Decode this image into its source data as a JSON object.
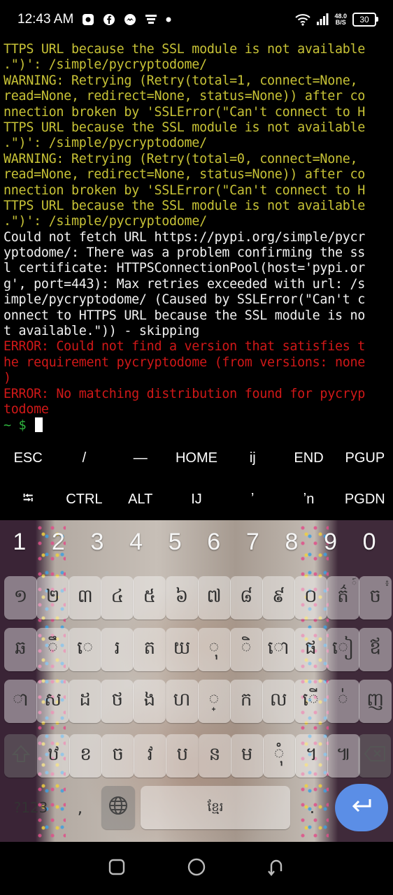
{
  "status_bar": {
    "time": "12:43 AM",
    "icons": [
      "messenger-icon",
      "facebook-icon",
      "messenger-circle-icon",
      "notification-icon",
      "dot-icon"
    ],
    "net_speed_value": "48.0",
    "net_speed_unit": "B/S",
    "battery": "30"
  },
  "terminal": {
    "lines": [
      {
        "text": "TTPS URL because the SSL module is not available",
        "style": "warn"
      },
      {
        "text": ".\")': /simple/pycryptodome/",
        "style": "warn"
      },
      {
        "text": "WARNING: Retrying (Retry(total=1, connect=None,",
        "style": "warn"
      },
      {
        "text": "read=None, redirect=None, status=None)) after co",
        "style": "warn"
      },
      {
        "text": "nnection broken by 'SSLError(\"Can't connect to H",
        "style": "warn"
      },
      {
        "text": "TTPS URL because the SSL module is not available",
        "style": "warn"
      },
      {
        "text": ".\")': /simple/pycryptodome/",
        "style": "warn"
      },
      {
        "text": "WARNING: Retrying (Retry(total=0, connect=None,",
        "style": "warn"
      },
      {
        "text": "read=None, redirect=None, status=None)) after co",
        "style": "warn"
      },
      {
        "text": "nnection broken by 'SSLError(\"Can't connect to H",
        "style": "warn"
      },
      {
        "text": "TTPS URL because the SSL module is not available",
        "style": "warn"
      },
      {
        "text": ".\")': /simple/pycryptodome/",
        "style": "warn"
      },
      {
        "text": "Could not fetch URL https://pypi.org/simple/pycr",
        "style": "norm"
      },
      {
        "text": "yptodome/: There was a problem confirming the ss",
        "style": "norm"
      },
      {
        "text": "l certificate: HTTPSConnectionPool(host='pypi.or",
        "style": "norm"
      },
      {
        "text": "g', port=443): Max retries exceeded with url: /s",
        "style": "norm"
      },
      {
        "text": "imple/pycryptodome/ (Caused by SSLError(\"Can't c",
        "style": "norm"
      },
      {
        "text": "onnect to HTTPS URL because the SSL module is no",
        "style": "norm"
      },
      {
        "text": "t available.\")) - skipping",
        "style": "norm"
      },
      {
        "text": "ERROR: Could not find a version that satisfies t",
        "style": "err"
      },
      {
        "text": "he requirement pycryptodome (from versions: none",
        "style": "err"
      },
      {
        "text": ")",
        "style": "err"
      },
      {
        "text": "ERROR: No matching distribution found for pycryp",
        "style": "err"
      },
      {
        "text": "todome",
        "style": "err"
      }
    ],
    "prompt": "~ $"
  },
  "extra_keys": {
    "row1": [
      "ESC",
      "/",
      "—",
      "HOME",
      "ij",
      "END",
      "PGUP"
    ],
    "row2": [
      "⭾",
      "CTRL",
      "ALT",
      "IJ",
      "ʼ",
      "ʼn",
      "PGDN"
    ]
  },
  "keyboard": {
    "numbers": [
      "1",
      "2",
      "3",
      "4",
      "5",
      "6",
      "7",
      "8",
      "9",
      "0"
    ],
    "row1": [
      {
        "label": "១"
      },
      {
        "label": "២"
      },
      {
        "label": "៣"
      },
      {
        "label": "៤"
      },
      {
        "label": "៥"
      },
      {
        "label": "៦"
      },
      {
        "label": "៧"
      },
      {
        "label": "៨"
      },
      {
        "label": "៩"
      },
      {
        "label": "០"
      },
      {
        "label": "ត៌",
        "hint": "៍"
      },
      {
        "label": "ច",
        "hint": "៖"
      }
    ],
    "row2": [
      {
        "label": "ឆ"
      },
      {
        "label": "ឹ"
      },
      {
        "label": "េ"
      },
      {
        "label": "រ"
      },
      {
        "label": "ត"
      },
      {
        "label": "យ"
      },
      {
        "label": "ុ"
      },
      {
        "label": "ិ"
      },
      {
        "label": "ោ"
      },
      {
        "label": "ផ"
      },
      {
        "label": "ៀ"
      },
      {
        "label": "ឪ"
      }
    ],
    "row3": [
      {
        "label": "ា"
      },
      {
        "label": "ស"
      },
      {
        "label": "ដ"
      },
      {
        "label": "ថ"
      },
      {
        "label": "ង"
      },
      {
        "label": "ហ"
      },
      {
        "label": "្"
      },
      {
        "label": "ក"
      },
      {
        "label": "ល"
      },
      {
        "label": "ើ"
      },
      {
        "label": "់"
      },
      {
        "label": "ញ"
      }
    ],
    "row4": [
      {
        "label": "ឋ"
      },
      {
        "label": "ខ"
      },
      {
        "label": "ច"
      },
      {
        "label": "វ"
      },
      {
        "label": "ប"
      },
      {
        "label": "ន"
      },
      {
        "label": "ម"
      },
      {
        "label": "ុំ"
      },
      {
        "label": "។"
      },
      {
        "label": "៕"
      }
    ],
    "symbols_label": "?123",
    "comma_label": ",",
    "space_label": "ខ្មែរ",
    "period_label": "."
  }
}
